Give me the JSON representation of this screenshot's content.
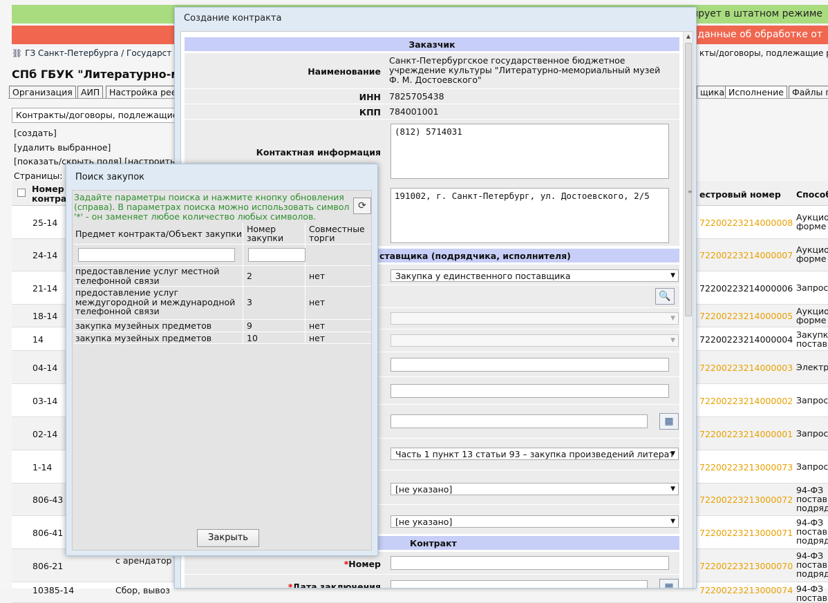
{
  "background": {
    "banner_green": "нирует в штатном режиме",
    "banner_red": "т данные об обработке от",
    "breadcrumb": "ГЗ Санкт-Петербурга / Государст",
    "breadcrumb_right": "кты/договоры, подлежащие р",
    "org_title": "СПб ГБУК \"Литературно-мем",
    "tabs": [
      "Организация",
      "АИП",
      "Настройка рее",
      "щика",
      "Исполнение",
      "Файлы п"
    ],
    "list_select": "Контракты/договоры, подлежащие",
    "commands": [
      "[создать]",
      "[удалить выбранное]",
      "[показать/скрыть поля] [настроить"
    ],
    "pages_label": "Страницы:",
    "grid_headers": {
      "number": "Номер контра",
      "registry": "естровый номер",
      "method": "Способ"
    },
    "rows": [
      {
        "num": "25-14",
        "reg": "72200223214000008",
        "meth": "Аукцио\nформе"
      },
      {
        "num": "24-14",
        "reg": "72200223214000007",
        "meth": "Аукцио\nформе"
      },
      {
        "num": "21-14",
        "reg": "72200223214000006",
        "meth": "Запрос"
      },
      {
        "num": "18-14",
        "reg": "72200223214000005",
        "meth": "Аукцио\nформе"
      },
      {
        "num": "14",
        "reg": "72200223214000004",
        "meth": "Закупк\nпостав"
      },
      {
        "num": "04-14",
        "reg": "72200223214000003",
        "meth": "Электр"
      },
      {
        "num": "03-14",
        "reg": "72200223214000002",
        "meth": "Запрос"
      },
      {
        "num": "02-14",
        "reg": "72200223214000001",
        "meth": "Запрос"
      },
      {
        "num": "1-14",
        "reg": "72200223213000073",
        "meth": "Запрос"
      },
      {
        "num": "806-43",
        "reg": "72200223213000072",
        "meth": "94-ФЗ \nпостав\nподряд"
      },
      {
        "num": "806-41",
        "reg": "72200223213000071",
        "meth": "94-ФЗ \nпостав\nподряд"
      },
      {
        "num": "806-21",
        "reg": "72200223213000070",
        "meth": "94-ФЗ \nпостав\nподряд"
      },
      {
        "num": "10385-14",
        "reg": "72200223213000074",
        "meth": "94-ФЗ \nпостав"
      }
    ],
    "row_806_21_subject": "с арендатор",
    "row_10385_subject": "Сбор, вывоз"
  },
  "contract_dialog": {
    "title": "Создание контракта",
    "section_customer": "Заказчик",
    "name_label": "Наименование",
    "name_value": "Санкт-Петербургское государственное бюджетное учреждение культуры \"Литературно-мемориальный музей Ф. М. Достоевского\"",
    "inn_label": "ИНН",
    "inn_value": "7825705438",
    "kpp_label": "КПП",
    "kpp_value": "784001001",
    "contact_label": "Контактная информация",
    "contact_phone": "(812) 5714031",
    "contact_address": "191002, г. Санкт-Петербург, ул. Достоевского, 2/5",
    "section_supplier": "ставщика (подрядчика, исполнителя)",
    "supplier_method": "Закупка у единственного поставщика",
    "legal_basis": "Часть 1 пункт 13 статьи 93 – закупка произведений литерат",
    "not_specified_1": "[не указано]",
    "not_specified_2": "[не указано]",
    "section_contract": "Контракт",
    "number_label": "Номер",
    "date_label": "Дата заключения"
  },
  "search_dialog": {
    "title": "Поиск закупок",
    "hint": "Задайте параметры поиска и нажмите кнопку обновления (справа). В параметрах поиска можно использовать символ '*' - он заменяет любое количество любых символов.",
    "columns": [
      "Предмет контракта/Объект закупки",
      "Номер закупки",
      "Совместные торги"
    ],
    "rows": [
      {
        "subject": "предоставление услуг местной телефонной связи",
        "number": "2",
        "joint": "нет"
      },
      {
        "subject": "предоставление услуг междугородной и международной телефонной связи",
        "number": "3",
        "joint": "нет"
      },
      {
        "subject": "закупка музейных предметов",
        "number": "9",
        "joint": "нет"
      },
      {
        "subject": "закупка музейных предметов",
        "number": "10",
        "joint": "нет"
      }
    ],
    "close_label": "Закрыть"
  },
  "colors": {
    "accent_orange": "#e8a000",
    "section_blue": "#c7cef7",
    "hint_green": "#2f8f2f"
  }
}
